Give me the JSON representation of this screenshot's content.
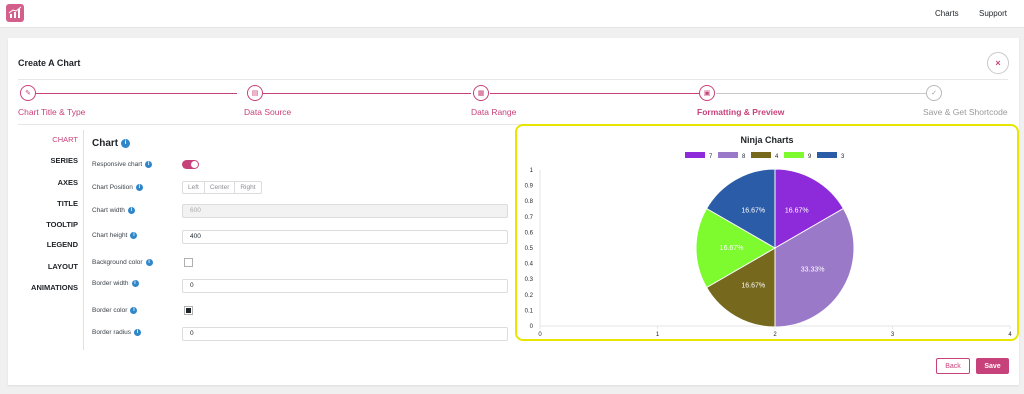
{
  "topnav": {
    "charts": "Charts",
    "support": "Support"
  },
  "header": {
    "title": "Create A Chart",
    "close_symbol": "×"
  },
  "steps": [
    {
      "label": "Chart Title & Type",
      "icon": "pencil-icon",
      "glyph": "✎"
    },
    {
      "label": "Data Source",
      "icon": "document-icon",
      "glyph": "▤"
    },
    {
      "label": "Data Range",
      "icon": "table-icon",
      "glyph": "▦"
    },
    {
      "label": "Formatting & Preview",
      "icon": "monitor-icon",
      "glyph": "▣"
    },
    {
      "label": "Save & Get Shortcode",
      "icon": "check-icon",
      "glyph": "✓"
    }
  ],
  "sidebar": {
    "items": [
      "CHART",
      "SERIES",
      "AXES",
      "TITLE",
      "TOOLTIP",
      "LEGEND",
      "LAYOUT",
      "ANIMATIONS"
    ]
  },
  "section": {
    "title": "Chart",
    "info_glyph": "i"
  },
  "fields": {
    "responsive_label": "Responsive chart",
    "position_label": "Chart Position",
    "position_options": [
      "Left",
      "Center",
      "Right"
    ],
    "width_label": "Chart width",
    "width_value": "600",
    "height_label": "Chart height",
    "height_value": "400",
    "bg_color_label": "Background color",
    "border_width_label": "Border width",
    "border_width_value": "0",
    "border_color_label": "Border color",
    "border_radius_label": "Border radius",
    "border_radius_value": "0"
  },
  "buttons": {
    "back": "Back",
    "save": "Save"
  },
  "colors": {
    "accent": "#c7427a",
    "highlight": "#e8e600",
    "info": "#2f86c8"
  },
  "chart_data": {
    "type": "pie",
    "title": "Ninja Charts",
    "legend_position": "top",
    "series": [
      {
        "name": "7",
        "value": 1,
        "label": "16.67%",
        "color": "#8d2ad9"
      },
      {
        "name": "8",
        "value": 2,
        "label": "33.33%",
        "color": "#9b79c9"
      },
      {
        "name": "4",
        "value": 1,
        "label": "16.67%",
        "color": "#76681c"
      },
      {
        "name": "9",
        "value": 1,
        "label": "16.67%",
        "color": "#7dfb2f"
      },
      {
        "name": "3",
        "value": 1,
        "label": "16.67%",
        "color": "#2b5ca8"
      }
    ],
    "y_ticks": [
      "0",
      "0.1",
      "0.2",
      "0.3",
      "0.4",
      "0.5",
      "0.6",
      "0.7",
      "0.8",
      "0.9",
      "1"
    ],
    "x_ticks": [
      "0",
      "1",
      "2",
      "3",
      "4"
    ],
    "ylim": [
      0,
      1
    ],
    "xlim": [
      0,
      4
    ]
  }
}
